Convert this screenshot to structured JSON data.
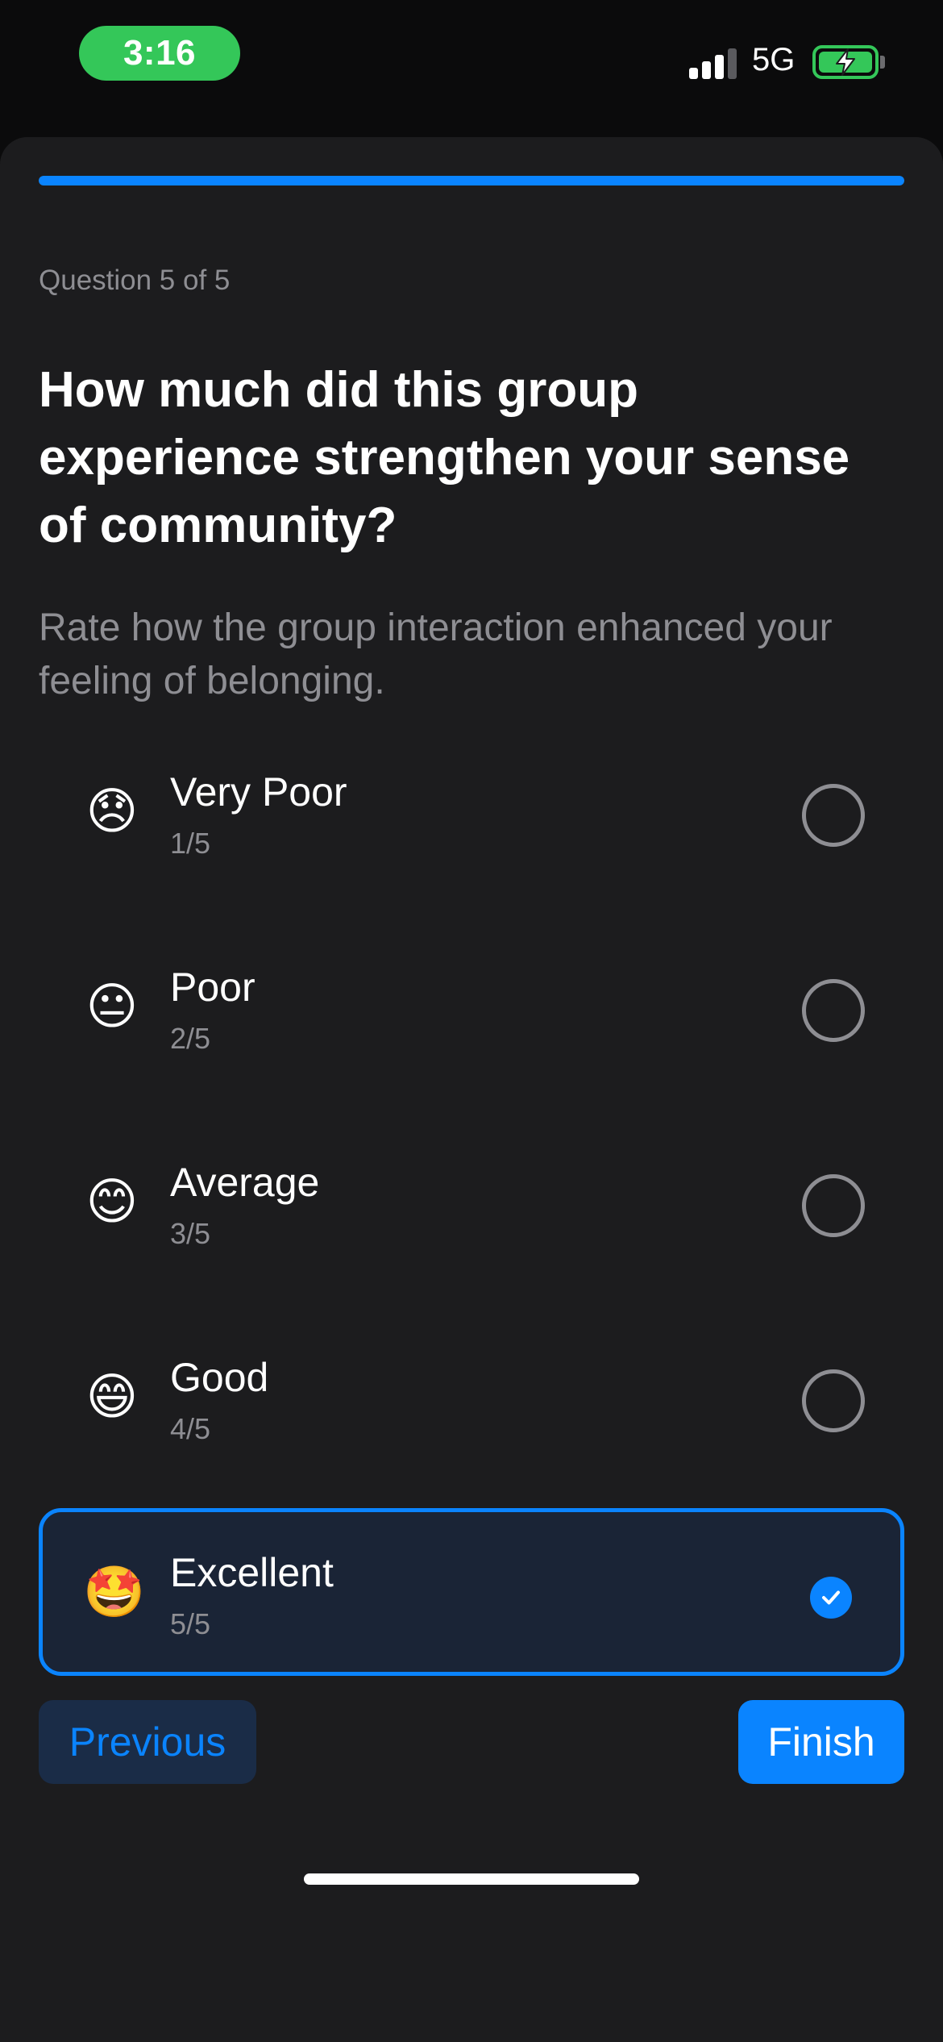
{
  "status_bar": {
    "time": "3:16",
    "network": "5G",
    "icons": [
      "signal-icon",
      "battery-charging-icon"
    ]
  },
  "progress": {
    "fraction": 1.0,
    "counter": "Question 5 of 5"
  },
  "question": {
    "title": "How much did this group experience strengthen your sense of community?",
    "subtitle": "Rate how the group interaction enhanced your feeling of belonging."
  },
  "options": [
    {
      "emoji": "😞",
      "label": "Very Poor",
      "score": "1/5",
      "selected": false
    },
    {
      "emoji": "😐",
      "label": "Poor",
      "score": "2/5",
      "selected": false
    },
    {
      "emoji": "😊",
      "label": "Average",
      "score": "3/5",
      "selected": false
    },
    {
      "emoji": "😄",
      "label": "Good",
      "score": "4/5",
      "selected": false
    },
    {
      "emoji": "🤩",
      "label": "Excellent",
      "score": "5/5",
      "selected": true
    }
  ],
  "buttons": {
    "previous": "Previous",
    "finish": "Finish"
  },
  "colors": {
    "accent": "#0a84ff",
    "background": "#1c1c1e",
    "status_time_pill": "#34c759",
    "secondary_text": "#8e8e93"
  }
}
